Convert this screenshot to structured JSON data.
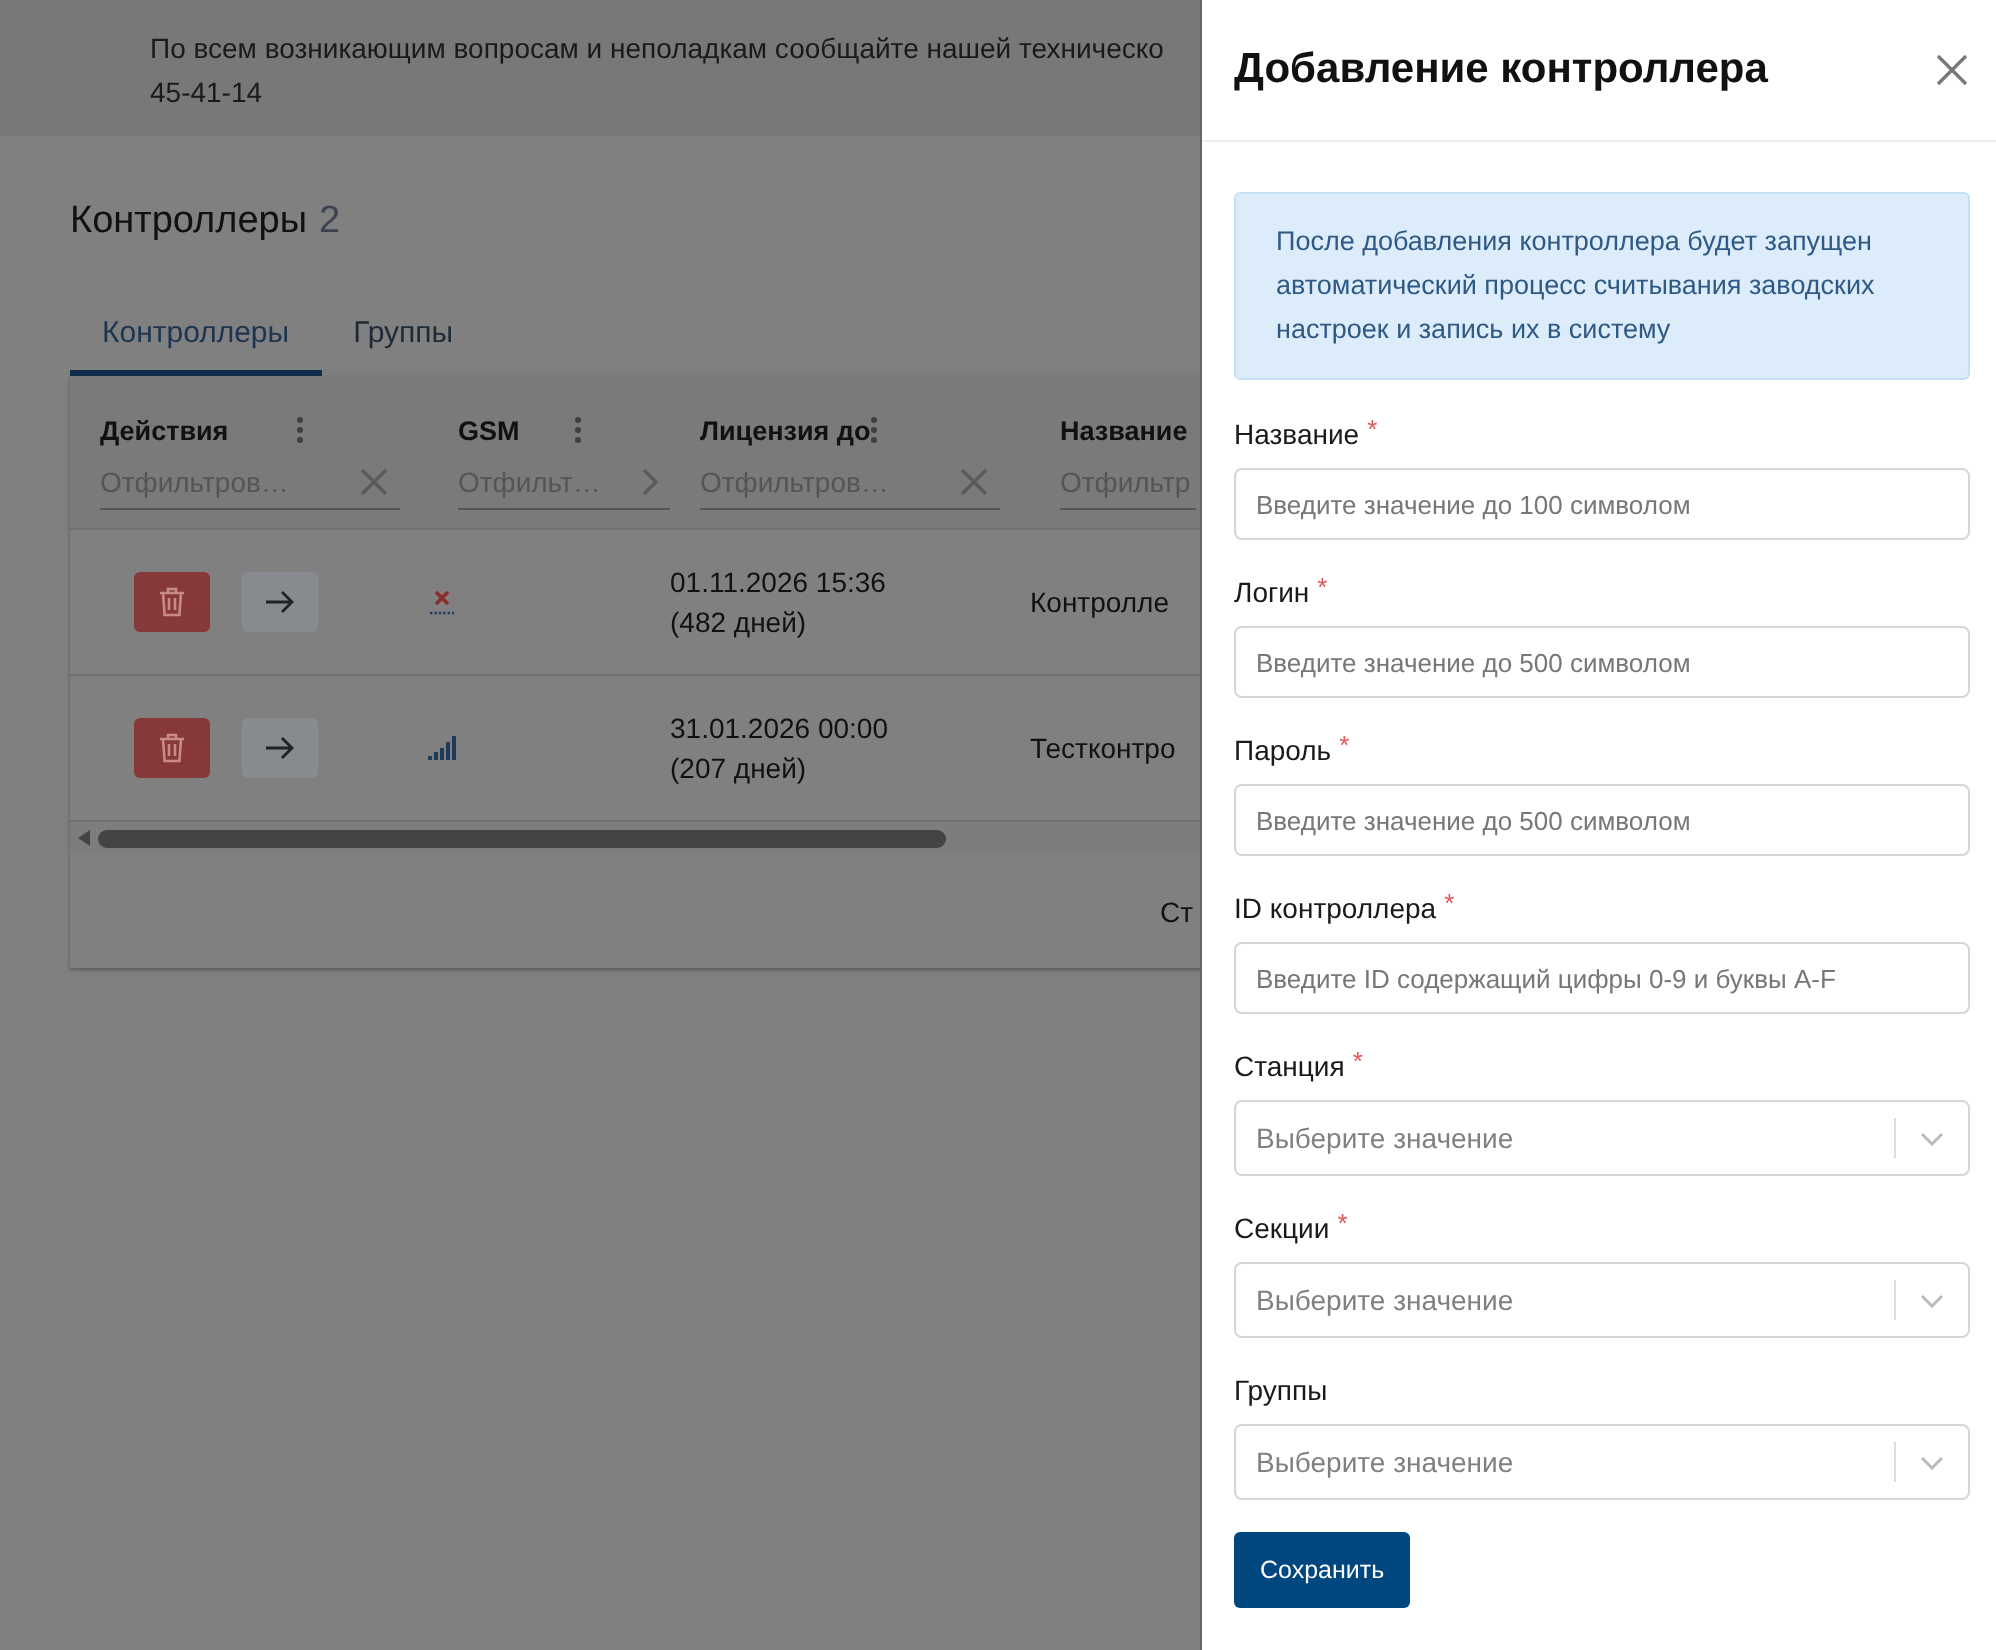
{
  "banner": {
    "lines": [
      "По всем возникающим вопросам и неполадкам сообщайте нашей техническо",
      "45-41-14"
    ]
  },
  "page": {
    "title": "Контроллеры",
    "count": "2"
  },
  "tabs": [
    {
      "label": "Контроллеры",
      "selected": true
    },
    {
      "label": "Группы",
      "selected": false
    }
  ],
  "table": {
    "columns": [
      {
        "title": "Действия",
        "menu": true,
        "filter": {
          "placeholder": "Отфильтров…",
          "kind": "clear"
        }
      },
      {
        "title": "GSM",
        "menu": true,
        "filter": {
          "placeholder": "Отфильт…",
          "kind": "expand"
        }
      },
      {
        "title": "Лицензия до",
        "menu": true,
        "filter": {
          "placeholder": "Отфильтров…",
          "kind": "clear"
        }
      },
      {
        "title": "Название",
        "menu": false,
        "filter": {
          "placeholder": "Отфильтр",
          "kind": "plain"
        }
      }
    ],
    "rows": [
      {
        "gsm": {
          "kind": "no-signal"
        },
        "license_date": "01.11.2026 15:36",
        "license_days": "(482 дней)",
        "name": "Контролле"
      },
      {
        "gsm": {
          "kind": "signal"
        },
        "license_date": "31.01.2026 00:00",
        "license_days": "(207 дней)",
        "name": "Тестконтро"
      }
    ],
    "footer_text": "Ст"
  },
  "drawer": {
    "title": "Добавление контроллера",
    "info": "После добавления контроллера будет запущен автоматический процесс считывания заводских настроек и запись их в систему",
    "fields": [
      {
        "kind": "text",
        "label": "Название",
        "required_mark": "*",
        "placeholder": "Введите значение до 100 символом"
      },
      {
        "kind": "text",
        "label": "Логин",
        "required_mark": "*",
        "placeholder": "Введите значение до 500 символом"
      },
      {
        "kind": "text",
        "label": "Пароль",
        "required_mark": "*",
        "placeholder": "Введите значение до 500 символом"
      },
      {
        "kind": "text",
        "label": "ID контроллера",
        "required_mark": "*",
        "placeholder": "Введите ID содержащий цифры 0-9 и буквы A-F"
      },
      {
        "kind": "select",
        "label": "Станция",
        "required_mark": "*",
        "placeholder": "Выберите значение"
      },
      {
        "kind": "select",
        "label": "Секции",
        "required_mark": "*",
        "placeholder": "Выберите значение"
      },
      {
        "kind": "select",
        "label": "Группы",
        "placeholder": "Выберите значение"
      }
    ],
    "submit": "Сохранить"
  }
}
